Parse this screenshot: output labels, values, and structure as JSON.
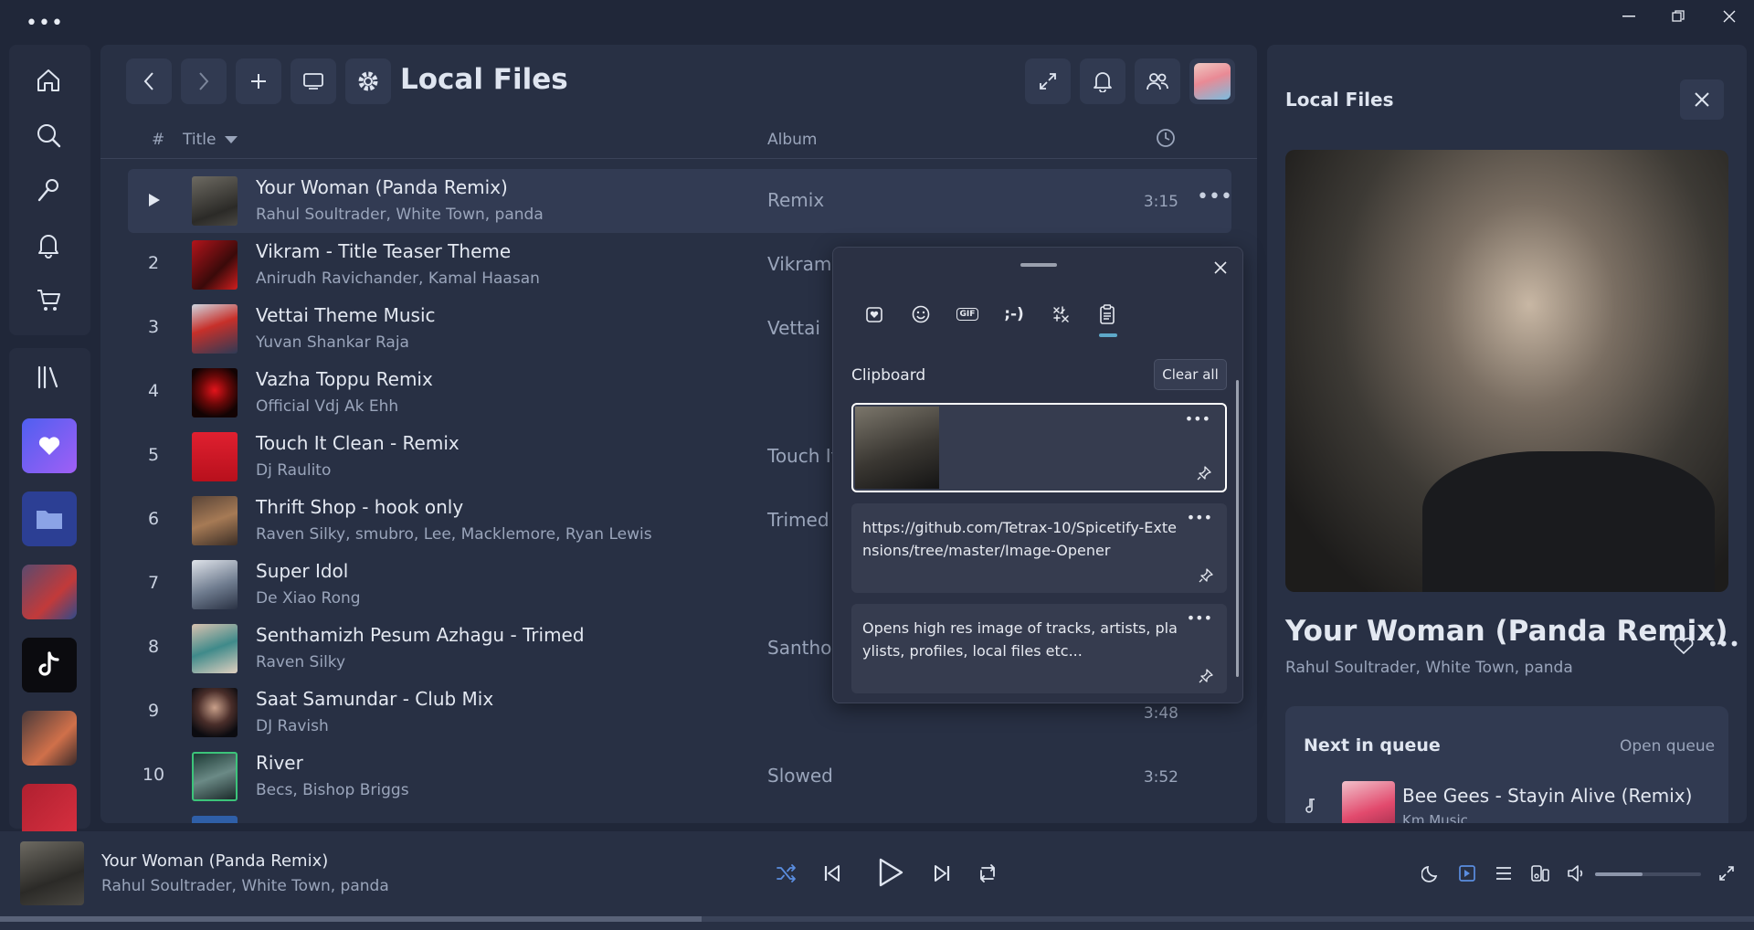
{
  "titlebar": {
    "menu_dots": "•••"
  },
  "header": {
    "page_title": "Local Files",
    "col_number": "#",
    "col_title": "Title",
    "col_album": "Album"
  },
  "tracks": [
    {
      "num": "",
      "title": "Your Woman (Panda Remix)",
      "artist": "Rahul Soultrader, White Town, panda",
      "album": "Remix",
      "duration": "3:15",
      "active": true
    },
    {
      "num": "2",
      "title": "Vikram - Title Teaser Theme",
      "artist": "Anirudh Ravichander, Kamal Haasan",
      "album": "Vikram",
      "duration": ""
    },
    {
      "num": "3",
      "title": "Vettai Theme Music",
      "artist": "Yuvan Shankar Raja",
      "album": "Vettai",
      "duration": ""
    },
    {
      "num": "4",
      "title": "Vazha Toppu Remix",
      "artist": "Official Vdj Ak Ehh",
      "album": "",
      "duration": ""
    },
    {
      "num": "5",
      "title": "Touch It Clean - Remix",
      "artist": "Dj Raulito",
      "album": "Touch It",
      "duration": ""
    },
    {
      "num": "6",
      "title": "Thrift Shop - hook only",
      "artist": "Raven Silky, smubro, Lee, Macklemore, Ryan Lewis",
      "album": "Trimed",
      "duration": ""
    },
    {
      "num": "7",
      "title": "Super Idol",
      "artist": "De Xiao Rong",
      "album": "",
      "duration": ""
    },
    {
      "num": "8",
      "title": "Senthamizh Pesum Azhagu - Trimed",
      "artist": "Raven Silky",
      "album": "Santhos",
      "duration": ""
    },
    {
      "num": "9",
      "title": "Saat Samundar - Club Mix",
      "artist": "DJ Ravish",
      "album": "",
      "duration": "3:48"
    },
    {
      "num": "10",
      "title": "River",
      "artist": "Becs, Bishop Briggs",
      "album": "Slowed",
      "duration": "3:52"
    }
  ],
  "clipboard": {
    "label": "Clipboard",
    "clear_all": "Clear all",
    "items": [
      {
        "type": "image",
        "text": ""
      },
      {
        "type": "text",
        "text": "https://github.com/Tetrax-10/Spicetify-Extensions/tree/master/Image-Opener"
      },
      {
        "type": "text",
        "text": "Opens high res image of tracks, artists, playlists, profiles, local files etc..."
      }
    ],
    "tabs": [
      "favorites-icon",
      "emoji-icon",
      "gif-icon",
      "kaomoji-icon",
      "symbols-icon",
      "clipboard-icon"
    ],
    "gif_label": "GIF",
    "kaomoji_label": ";-)"
  },
  "right_panel": {
    "title": "Local Files",
    "song": "Your Woman (Panda Remix)",
    "artist": "Rahul Soultrader, White Town, panda",
    "queue_heading": "Next in queue",
    "open_queue": "Open queue",
    "next_title": "Bee Gees - Stayin Alive (Remix)",
    "next_artist": "Km Music"
  },
  "player": {
    "title": "Your Woman (Panda Remix)",
    "artist": "Rahul Soultrader, White Town, panda",
    "progress": 0.4,
    "volume": 0.45
  },
  "colors": {
    "accent": "#5a8de0",
    "background": "#202739",
    "panel": "#283044"
  }
}
